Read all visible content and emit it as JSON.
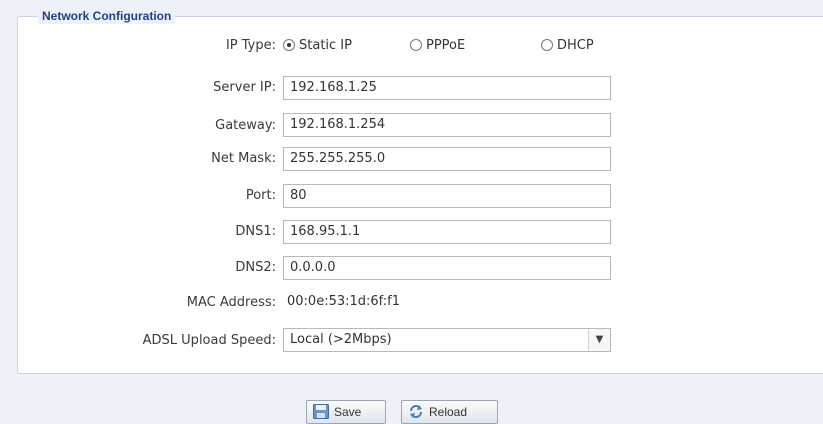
{
  "section": {
    "legend": "Network Configuration"
  },
  "ip_type": {
    "label": "IP Type:",
    "options": [
      {
        "label": "Static IP",
        "checked": true
      },
      {
        "label": "PPPoE",
        "checked": false
      },
      {
        "label": "DHCP",
        "checked": false
      }
    ]
  },
  "fields": {
    "server_ip": {
      "label": "Server IP:",
      "value": "192.168.1.25"
    },
    "gateway": {
      "label": "Gateway:",
      "value": "192.168.1.254"
    },
    "net_mask": {
      "label": "Net Mask:",
      "value": "255.255.255.0"
    },
    "port": {
      "label": "Port:",
      "value": "80"
    },
    "dns1": {
      "label": "DNS1:",
      "value": "168.95.1.1"
    },
    "dns2": {
      "label": "DNS2:",
      "value": "0.0.0.0"
    }
  },
  "mac": {
    "label": "MAC Address:",
    "value": "00:0e:53:1d:6f:f1"
  },
  "adsl": {
    "label": "ADSL Upload Speed:",
    "selected": "Local (>2Mbps)"
  },
  "buttons": {
    "save": "Save",
    "reload": "Reload"
  },
  "icons": {
    "save": "floppy-disk-icon",
    "reload": "refresh-icon",
    "select": "chevron-down-icon"
  }
}
